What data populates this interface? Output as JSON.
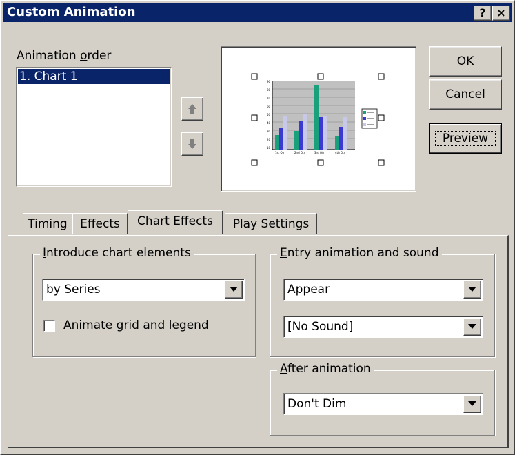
{
  "window": {
    "title": "Custom Animation",
    "help_btn": "?",
    "close_btn": "×"
  },
  "animation_order": {
    "label_pre": "Animation ",
    "label_access": "o",
    "label_post": "rder",
    "items": [
      "1. Chart 1"
    ],
    "selected_index": 0
  },
  "buttons": {
    "ok": "OK",
    "cancel": "Cancel",
    "preview_access": "P",
    "preview_rest": "review",
    "move_up_icon": "arrow-up-icon",
    "move_down_icon": "arrow-down-icon"
  },
  "tabs": [
    {
      "label": "Timing",
      "active": false
    },
    {
      "label": "Effects",
      "active": false
    },
    {
      "label": "Chart Effects",
      "active": true
    },
    {
      "label": "Play Settings",
      "active": false
    }
  ],
  "chart_effects": {
    "introduce": {
      "legend_access": "I",
      "legend_rest": "ntroduce chart elements",
      "value": "by Series"
    },
    "animate_grid": {
      "label_pre": "Ani",
      "label_access": "m",
      "label_post": "ate grid and legend",
      "checked": false
    },
    "entry": {
      "legend_access": "E",
      "legend_rest": "ntry animation and sound",
      "effect_value": "Appear",
      "sound_value": "[No Sound]"
    },
    "after": {
      "legend_access": "A",
      "legend_rest": "fter animation",
      "value": "Don't Dim"
    }
  },
  "colors": {
    "titlebar": "#0a246a",
    "face": "#d4d0c8",
    "series1": "#1aa07a",
    "series2": "#3a3ad0",
    "series3": "#c8c8e8"
  }
}
